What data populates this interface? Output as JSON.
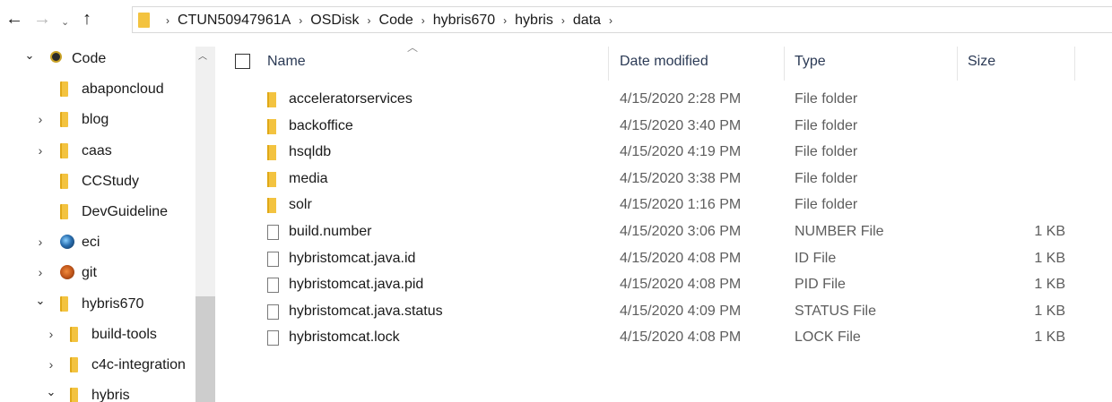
{
  "toolbar": {
    "back_glyph": "←",
    "forward_glyph": "→",
    "recent_glyph": "⌄",
    "up_glyph": "↑"
  },
  "breadcrumb": [
    "CTUN50947961A",
    "OSDisk",
    "Code",
    "hybris670",
    "hybris",
    "data"
  ],
  "breadcrumb_separator": "›",
  "nav": {
    "items": [
      {
        "label": "Code",
        "icon": "eclipse-icon",
        "chevron": "open"
      },
      {
        "label": "abaponcloud",
        "icon": "folder-icon",
        "chevron": "none"
      },
      {
        "label": "blog",
        "icon": "folder-icon",
        "chevron": "closed"
      },
      {
        "label": "caas",
        "icon": "folder-icon",
        "chevron": "closed"
      },
      {
        "label": "CCStudy",
        "icon": "folder-icon",
        "chevron": "none"
      },
      {
        "label": "DevGuideline",
        "icon": "folder-icon",
        "chevron": "none"
      },
      {
        "label": "eci",
        "icon": "eci-icon",
        "chevron": "closed"
      },
      {
        "label": "git",
        "icon": "git-icon",
        "chevron": "closed"
      },
      {
        "label": "hybris670",
        "icon": "folder-icon",
        "chevron": "open"
      },
      {
        "label": "build-tools",
        "icon": "folder-icon",
        "chevron": "closed"
      },
      {
        "label": "c4c-integration",
        "icon": "folder-icon",
        "chevron": "closed"
      },
      {
        "label": "hybris",
        "icon": "folder-icon",
        "chevron": "open"
      }
    ]
  },
  "columns": {
    "name": "Name",
    "date": "Date modified",
    "type": "Type",
    "size": "Size"
  },
  "files": [
    {
      "name": "acceleratorservices",
      "date": "4/15/2020 2:28 PM",
      "type": "File folder",
      "size": "",
      "kind": "folder"
    },
    {
      "name": "backoffice",
      "date": "4/15/2020 3:40 PM",
      "type": "File folder",
      "size": "",
      "kind": "folder"
    },
    {
      "name": "hsqldb",
      "date": "4/15/2020 4:19 PM",
      "type": "File folder",
      "size": "",
      "kind": "folder"
    },
    {
      "name": "media",
      "date": "4/15/2020 3:38 PM",
      "type": "File folder",
      "size": "",
      "kind": "folder"
    },
    {
      "name": "solr",
      "date": "4/15/2020 1:16 PM",
      "type": "File folder",
      "size": "",
      "kind": "folder"
    },
    {
      "name": "build.number",
      "date": "4/15/2020 3:06 PM",
      "type": "NUMBER File",
      "size": "1 KB",
      "kind": "file"
    },
    {
      "name": "hybristomcat.java.id",
      "date": "4/15/2020 4:08 PM",
      "type": "ID File",
      "size": "1 KB",
      "kind": "file"
    },
    {
      "name": "hybristomcat.java.pid",
      "date": "4/15/2020 4:08 PM",
      "type": "PID File",
      "size": "1 KB",
      "kind": "file"
    },
    {
      "name": "hybristomcat.java.status",
      "date": "4/15/2020 4:09 PM",
      "type": "STATUS File",
      "size": "1 KB",
      "kind": "file"
    },
    {
      "name": "hybristomcat.lock",
      "date": "4/15/2020 4:08 PM",
      "type": "LOCK File",
      "size": "1 KB",
      "kind": "file"
    }
  ]
}
